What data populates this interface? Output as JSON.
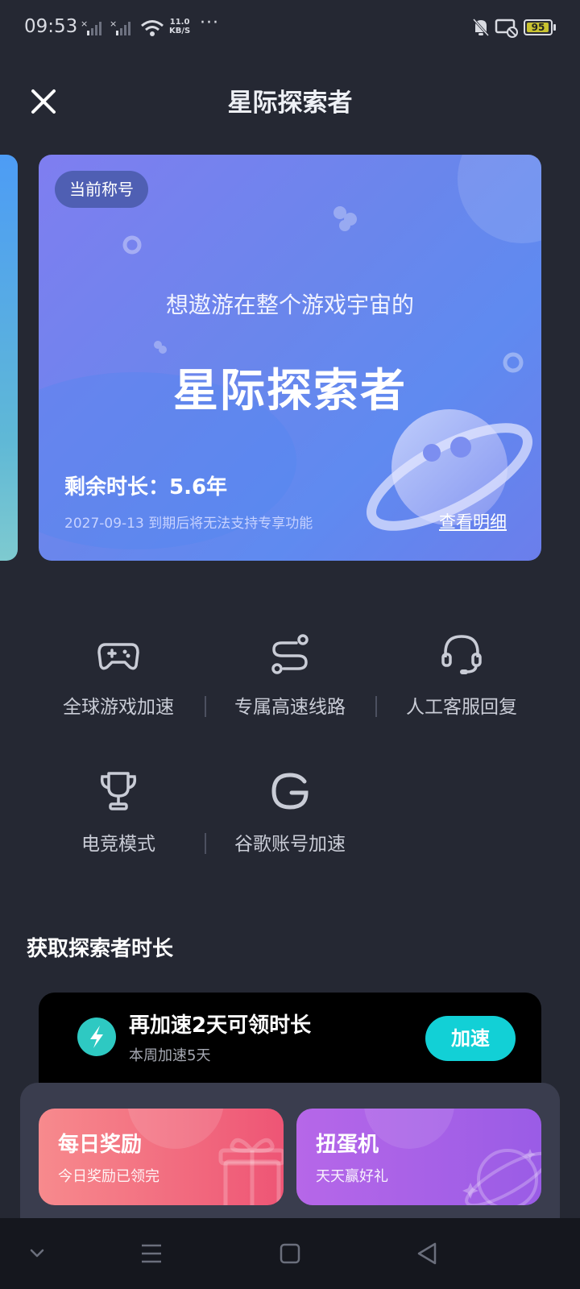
{
  "status_bar": {
    "time": "09:53",
    "net_speed_value": "11.0",
    "net_speed_unit": "KB/S",
    "more": "···",
    "battery": "95",
    "battery_level": 0.95,
    "icons": [
      "signal-1-icon",
      "signal-2-icon",
      "wifi-icon",
      "bell-off-icon",
      "cast-icon",
      "battery-icon"
    ]
  },
  "header": {
    "title": "星际探索者",
    "close_icon": "close-icon"
  },
  "card": {
    "badge": "当前称号",
    "subtitle": "想遨游在整个游戏宇宙的",
    "title": "星际探索者",
    "remaining": "剩余时长：5.6年",
    "expiry_note": "2027-09-13 到期后将无法支持专享功能",
    "detail_link": "查看明细",
    "illustration": "planet-icon"
  },
  "features": [
    {
      "label": "全球游戏加速",
      "icon": "gamepad-icon"
    },
    {
      "label": "专属高速线路",
      "icon": "route-icon"
    },
    {
      "label": "人工客服回复",
      "icon": "headset-icon"
    },
    {
      "label": "电竞模式",
      "icon": "trophy-icon"
    },
    {
      "label": "谷歌账号加速",
      "icon": "google-icon"
    }
  ],
  "section": {
    "title": "获取探索者时长"
  },
  "task": {
    "title": "再加速2天可领时长",
    "subtitle": "本周加速5天",
    "button": "加速",
    "icon": "lightning-icon"
  },
  "tiles": [
    {
      "title": "每日奖励",
      "subtitle": "今日奖励已领完",
      "icon": "gift-icon"
    },
    {
      "title": "扭蛋机",
      "subtitle": "天天赢好礼",
      "icon": "planet-icon"
    }
  ],
  "nav": [
    "chevron-down-icon",
    "menu-icon",
    "home-square-icon",
    "back-triangle-icon"
  ],
  "colors": {
    "background": "#252833",
    "accent": "#12d0d6",
    "daily_tile": "#ee5575",
    "gacha_tile": "#9a5ce6",
    "card": "#6a86ec"
  }
}
